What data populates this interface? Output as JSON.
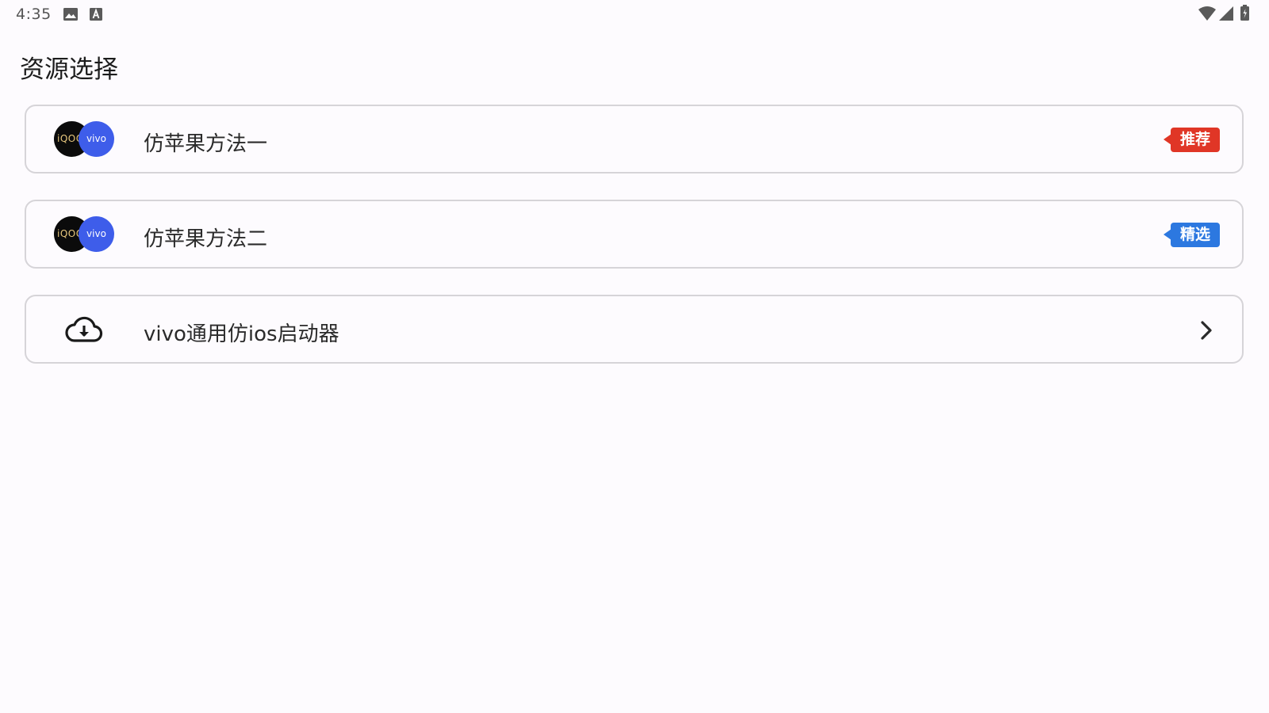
{
  "status_bar": {
    "time": "4:35",
    "left_icons": [
      "image-icon",
      "a-square-icon"
    ],
    "right_icons": [
      "wifi-icon",
      "signal-icon",
      "battery-icon"
    ]
  },
  "page": {
    "title": "资源选择"
  },
  "cards": [
    {
      "label": "仿苹果方法一",
      "logo": {
        "left_text": "iQOO",
        "right_text": "vivo"
      },
      "badge": {
        "text": "推荐",
        "color": "#e03626"
      }
    },
    {
      "label": "仿苹果方法二",
      "logo": {
        "left_text": "iQOO",
        "right_text": "vivo"
      },
      "badge": {
        "text": "精选",
        "color": "#2c78e0"
      }
    },
    {
      "label": "vivo通用仿ios启动器",
      "icon": "cloud-download-icon",
      "trailing_icon": "chevron-right-icon"
    }
  ]
}
